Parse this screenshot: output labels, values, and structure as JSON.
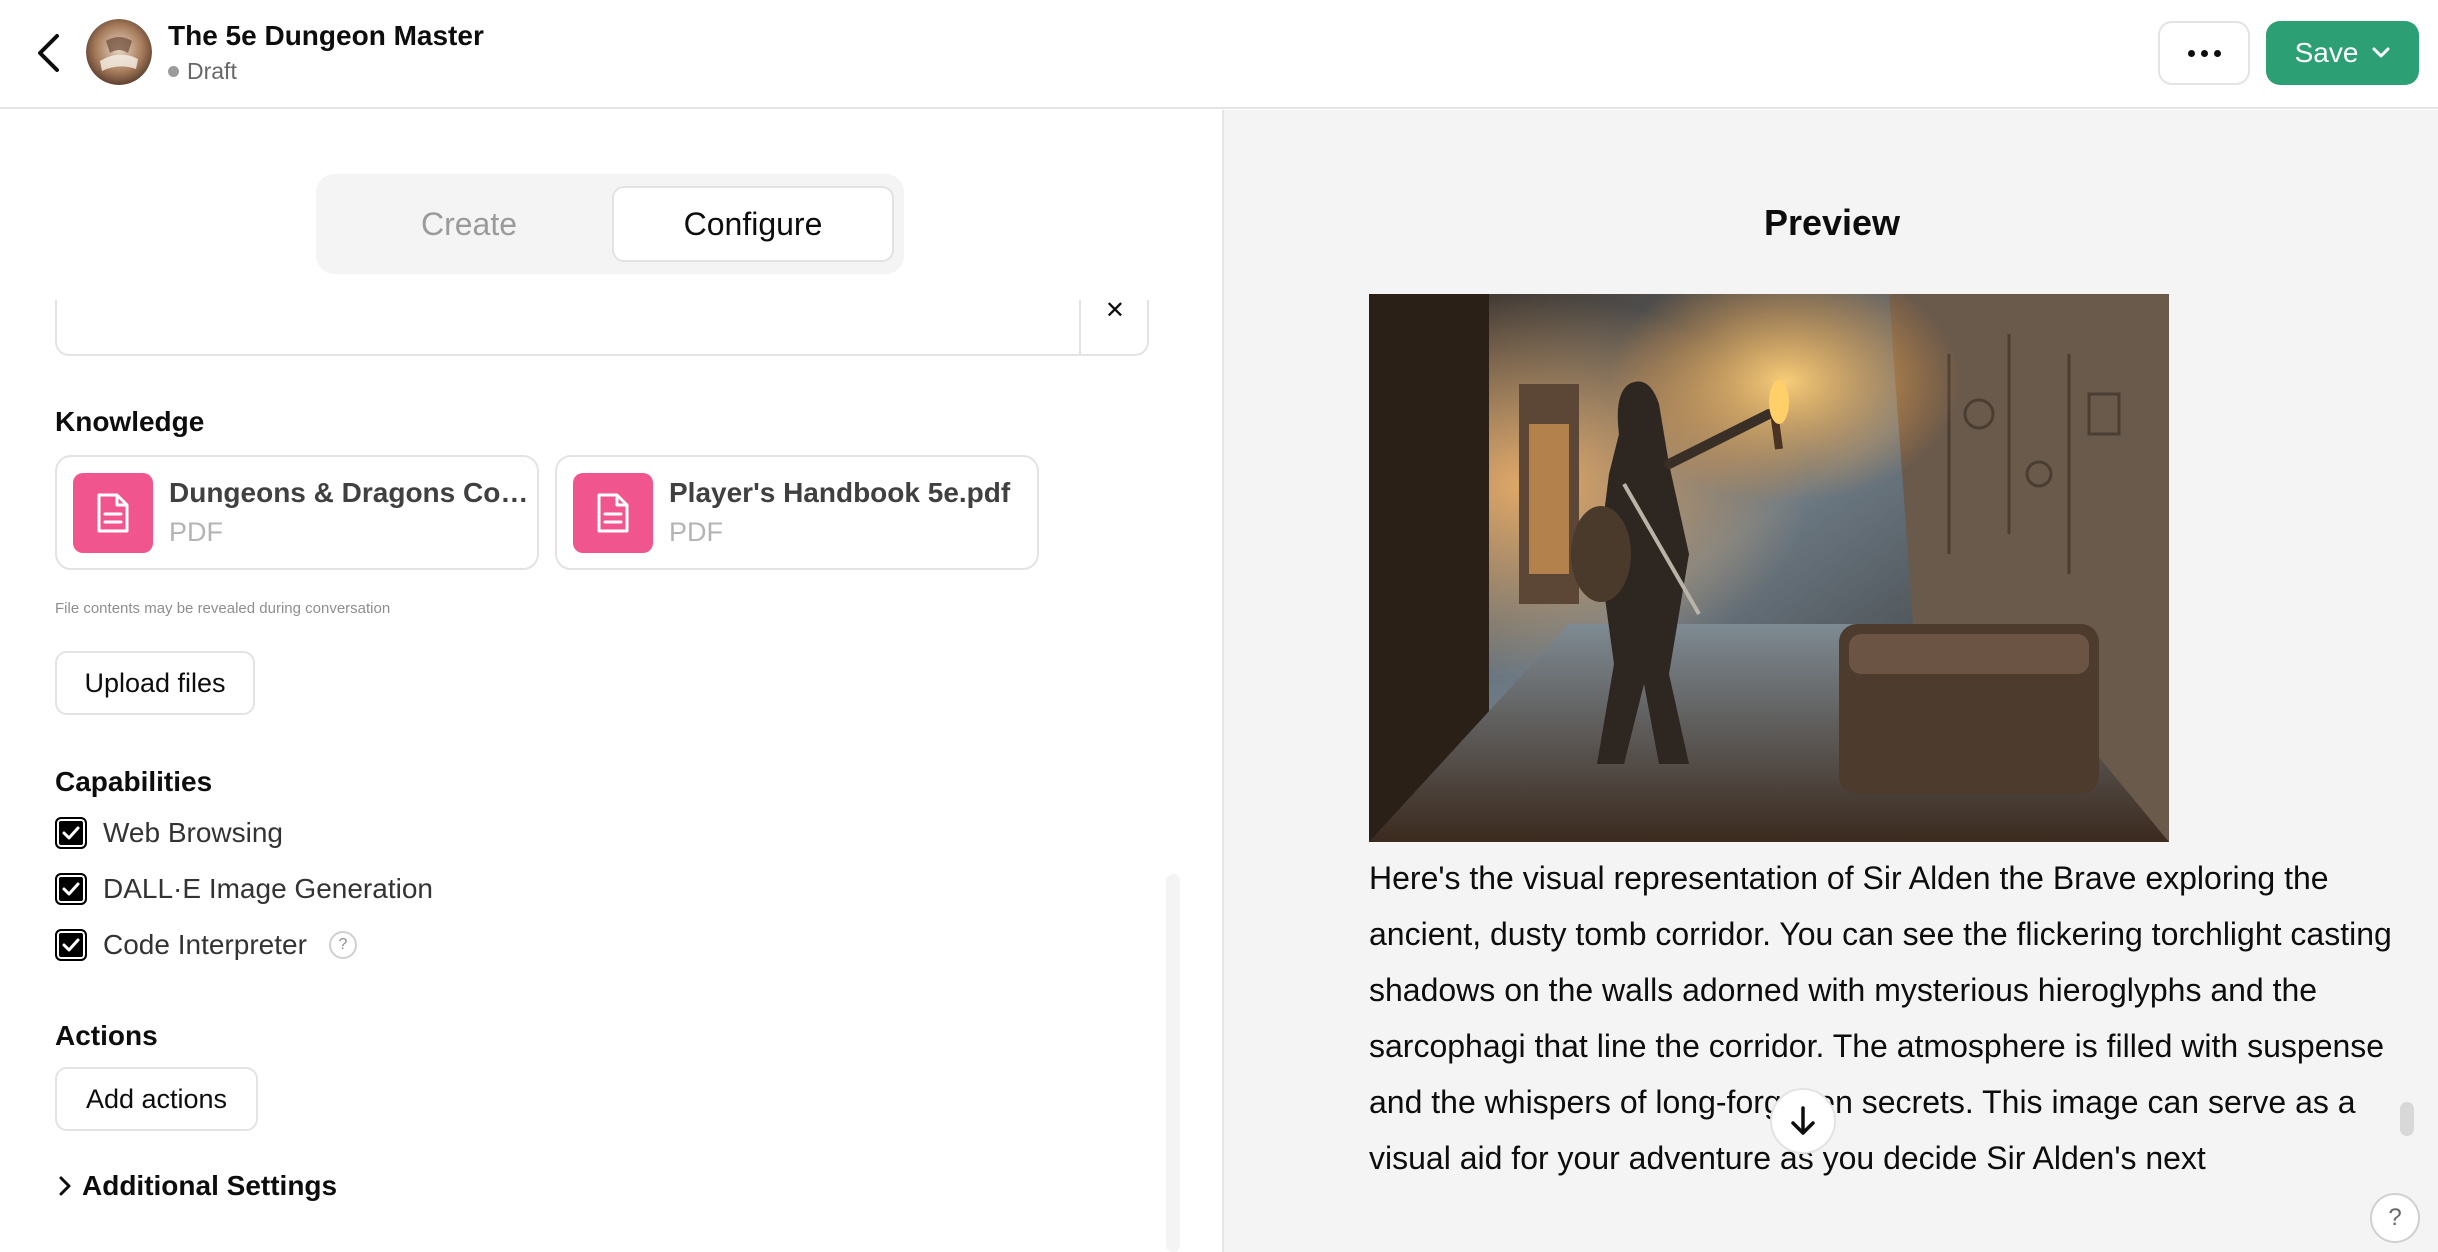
{
  "header": {
    "title": "The 5e Dungeon Master",
    "status": "Draft",
    "save_label": "Save",
    "icons": {
      "back": "chevron-left-icon",
      "more": "ellipsis-icon",
      "save_dropdown": "chevron-down-icon"
    }
  },
  "tabs": [
    {
      "label": "Create",
      "active": false
    },
    {
      "label": "Configure",
      "active": true
    }
  ],
  "knowledge": {
    "label": "Knowledge",
    "files": [
      {
        "name": "Dungeons & Dragons Core...",
        "type": "PDF",
        "icon": "document-icon"
      },
      {
        "name": "Player's Handbook 5e.pdf",
        "type": "PDF",
        "icon": "document-icon"
      }
    ],
    "note": "File contents may be revealed during conversation",
    "upload_label": "Upload files"
  },
  "capabilities": {
    "label": "Capabilities",
    "items": [
      {
        "label": "Web Browsing",
        "checked": true
      },
      {
        "label": "DALL·E Image Generation",
        "checked": true
      },
      {
        "label": "Code Interpreter",
        "checked": true,
        "help": "?"
      }
    ]
  },
  "actions": {
    "label": "Actions",
    "add_label": "Add actions"
  },
  "additional_settings": "Additional Settings",
  "preview": {
    "title": "Preview",
    "message": "Here's the visual representation of Sir Alden the Brave exploring the ancient, dusty tomb corridor. You can see the flickering torchlight casting shadows on the walls adorned with mysterious hieroglyphs and the sarcophagi that line the corridor. The atmosphere is filled with suspense and the whispers of long-forgotten secrets. This image can serve as a visual aid for your adventure as you decide Sir Alden's next",
    "help": "?"
  },
  "colors": {
    "save_button": "#2d9f75",
    "file_icon": "#f0558e",
    "preview_bg": "#f4f4f4"
  }
}
